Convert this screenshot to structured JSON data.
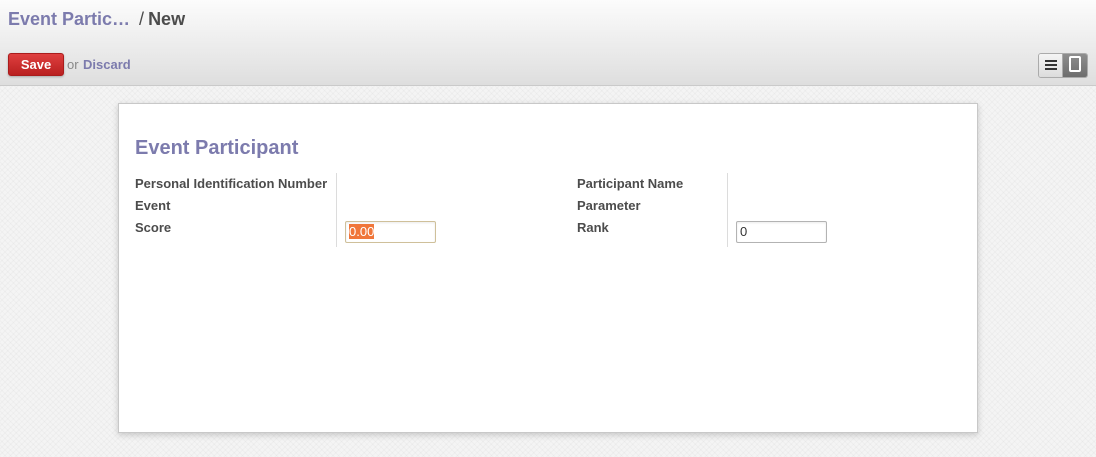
{
  "breadcrumb": {
    "parent": "Event Partic…",
    "separator": "/",
    "current": "New"
  },
  "toolbar": {
    "save_label": "Save",
    "or_text": "or",
    "discard_label": "Discard"
  },
  "view_switcher": {
    "list_icon": "list-icon",
    "form_icon": "form-icon",
    "active": "form"
  },
  "form": {
    "title": "Event Participant",
    "left_fields": [
      {
        "label": "Personal Identification Number",
        "value": ""
      },
      {
        "label": "Event",
        "value": ""
      },
      {
        "label": "Score",
        "value": "0.00"
      }
    ],
    "right_fields": [
      {
        "label": "Participant Name",
        "value": ""
      },
      {
        "label": "Parameter",
        "value": ""
      },
      {
        "label": "Rank",
        "value": "0"
      }
    ]
  },
  "colors": {
    "accent": "#7c7bad",
    "save_button": "#c9282d",
    "selection": "#f0763a"
  }
}
